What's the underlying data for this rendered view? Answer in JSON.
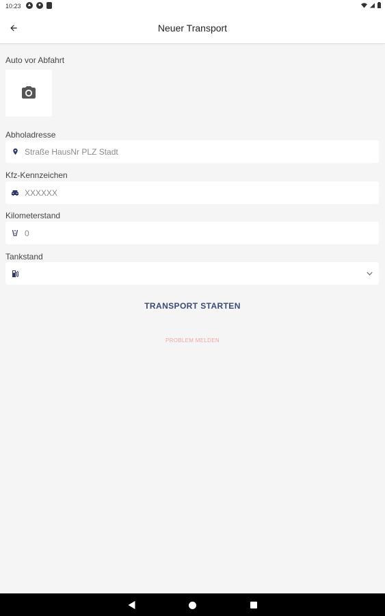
{
  "status_bar": {
    "time": "10:23",
    "icons_left": [
      "app-notification-icon",
      "chrome-icon",
      "sd-card-icon"
    ],
    "icons_right": [
      "wifi-icon",
      "signal-icon",
      "battery-icon"
    ]
  },
  "app_bar": {
    "title": "Neuer Transport",
    "back_icon": "arrow-back-icon"
  },
  "form": {
    "photo_label": "Auto vor Abfahrt",
    "photo_icon": "camera-icon",
    "pickup": {
      "label": "Abholadresse",
      "placeholder": "Straße HausNr PLZ Stadt",
      "value": "",
      "icon": "location-pin-icon"
    },
    "plate": {
      "label": "Kfz-Kennzeichen",
      "placeholder": "XXXXXX",
      "value": "",
      "icon": "car-icon"
    },
    "mileage": {
      "label": "Kilometerstand",
      "placeholder": "0",
      "value": "",
      "icon": "odometer-icon"
    },
    "fuel": {
      "label": "Tankstand",
      "selected": "",
      "icon": "fuel-icon"
    }
  },
  "actions": {
    "start_label": "TRANSPORT STARTEN",
    "report_label": "PROBLEM MELDEN"
  },
  "colors": {
    "accent": "#3c4a78",
    "icon": "#2f3a6b",
    "danger_light": "#f0a6a6",
    "background": "#f5f5f5"
  },
  "nav_bar": {
    "icons": [
      "nav-back-icon",
      "nav-home-icon",
      "nav-recents-icon"
    ]
  }
}
